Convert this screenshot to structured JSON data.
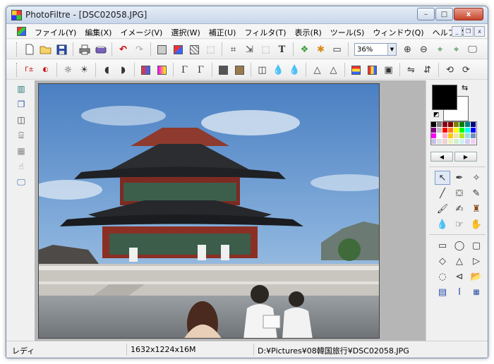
{
  "window": {
    "title": "PhotoFiltre - [DSC02058.JPG]",
    "controls": {
      "minimize": "–",
      "maximize": "□",
      "close": "x"
    }
  },
  "menu": {
    "items": [
      "ファイル(Y)",
      "編集(X)",
      "イメージ(V)",
      "選択(W)",
      "補正(U)",
      "フィルタ(T)",
      "表示(R)",
      "ツール(S)",
      "ウィンドウ(Q)",
      "ヘルプ(Z)"
    ],
    "mdi_controls": {
      "minimize": "_",
      "restore": "❐",
      "close": "x"
    }
  },
  "toolbar": {
    "zoom_value": "36%",
    "text_tool_glyph": "T"
  },
  "palette": {
    "colors": [
      "#000000",
      "#7f7f7f",
      "#880015",
      "#7f0000",
      "#808000",
      "#008000",
      "#008080",
      "#000080",
      "#800080",
      "#c3c3c3",
      "#ff0000",
      "#ff7f27",
      "#ffff00",
      "#00ff00",
      "#00ffff",
      "#0000ff",
      "#ff00ff",
      "#ffffff",
      "#ffaec9",
      "#ffc90e",
      "#efe4b0",
      "#b5e61d",
      "#99d9ea",
      "#7092be",
      "#c8bfe7",
      "#e0e0e0",
      "#f0d0d0",
      "#f0f0c0",
      "#d0f0d0",
      "#d0f0f0",
      "#d0d0f0",
      "#f0d0f0"
    ],
    "foreground": "#000000",
    "background": "#ffffff"
  },
  "status": {
    "state": "レディ",
    "dimensions": "1632x1224x16M",
    "path": "D:¥Pictures¥08韓国旅行¥DSC02058.JPG"
  }
}
